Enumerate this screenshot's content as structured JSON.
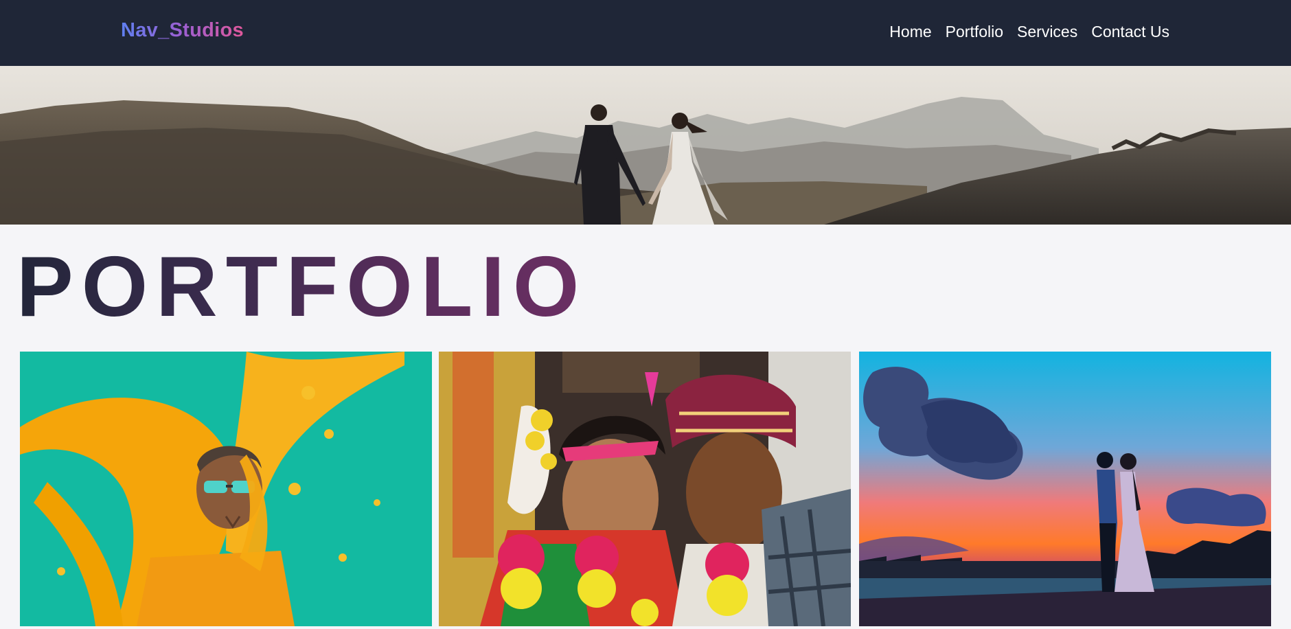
{
  "brand": {
    "name": "Nav_Studios"
  },
  "nav": {
    "items": [
      {
        "label": "Home"
      },
      {
        "label": "Portfolio"
      },
      {
        "label": "Services"
      },
      {
        "label": "Contact Us"
      }
    ]
  },
  "hero": {
    "image": "couple-walking-mountains"
  },
  "page": {
    "heading": "PORTFOLIO"
  },
  "gallery": {
    "items": [
      {
        "image": "man-yellow-haldi-splash"
      },
      {
        "image": "traditional-wedding-couple"
      },
      {
        "image": "couple-sunset-pier"
      }
    ]
  },
  "colors": {
    "navbar_bg": "#1f2637",
    "page_bg": "#f5f5f8",
    "nav_text": "#ffffff",
    "logo_gradient": [
      "#5f7ff0",
      "#e0589a"
    ],
    "heading_gradient": [
      "#23263a",
      "#6b2f63"
    ]
  }
}
